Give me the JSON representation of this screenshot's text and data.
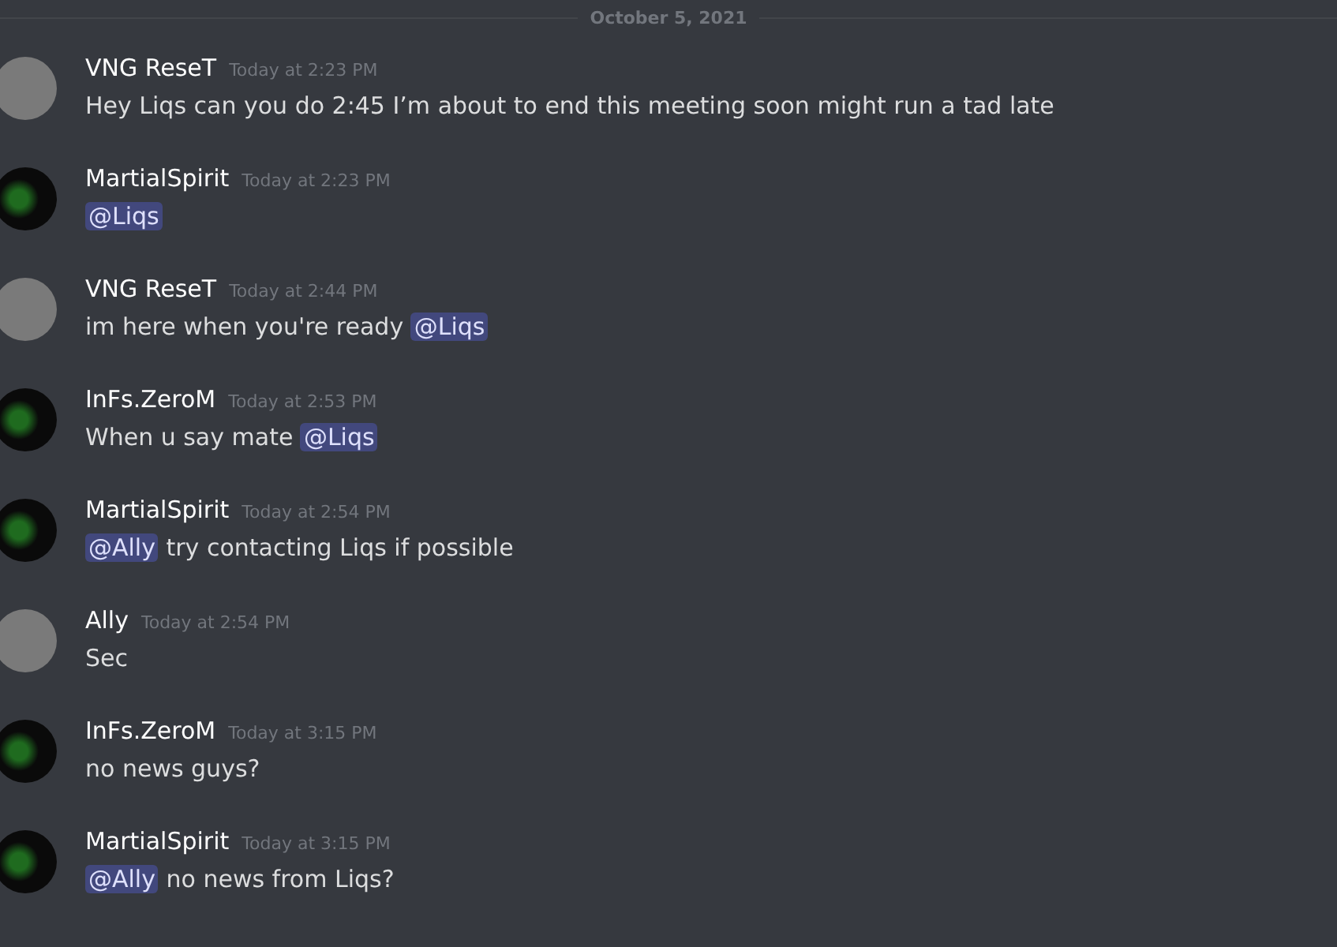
{
  "date_divider": "October 5, 2021",
  "messages": [
    {
      "author": "VNG ReseT",
      "kind": "photo",
      "time": "Today at 2:23 PM",
      "parts": [
        {
          "kind": "text",
          "text": "Hey Liqs can you do 2:45 I’m about to end this meeting soon might run a tad late"
        }
      ]
    },
    {
      "author": "MartialSpirit",
      "kind": "logo",
      "time": "Today at 2:23 PM",
      "parts": [
        {
          "kind": "mention",
          "text": "@Liqs"
        }
      ]
    },
    {
      "author": "VNG ReseT",
      "kind": "photo",
      "time": "Today at 2:44 PM",
      "parts": [
        {
          "kind": "text",
          "text": "im here when you're ready "
        },
        {
          "kind": "mention",
          "text": "@Liqs"
        }
      ]
    },
    {
      "author": "InFs.ZeroM",
      "kind": "logo",
      "time": "Today at 2:53 PM",
      "parts": [
        {
          "kind": "text",
          "text": "When u say mate "
        },
        {
          "kind": "mention",
          "text": "@Liqs"
        }
      ]
    },
    {
      "author": "MartialSpirit",
      "kind": "logo",
      "time": "Today at 2:54 PM",
      "parts": [
        {
          "kind": "mention",
          "text": "@Ally"
        },
        {
          "kind": "text",
          "text": " try contacting Liqs if possible"
        }
      ]
    },
    {
      "author": "Ally",
      "kind": "photo",
      "time": "Today at 2:54 PM",
      "parts": [
        {
          "kind": "text",
          "text": "Sec"
        }
      ]
    },
    {
      "author": "InFs.ZeroM",
      "kind": "logo",
      "time": "Today at 3:15 PM",
      "parts": [
        {
          "kind": "text",
          "text": "no news guys?"
        }
      ]
    },
    {
      "author": "MartialSpirit",
      "kind": "logo",
      "time": "Today at 3:15 PM",
      "parts": [
        {
          "kind": "mention",
          "text": "@Ally"
        },
        {
          "kind": "text",
          "text": " no news from Liqs?"
        }
      ]
    }
  ]
}
